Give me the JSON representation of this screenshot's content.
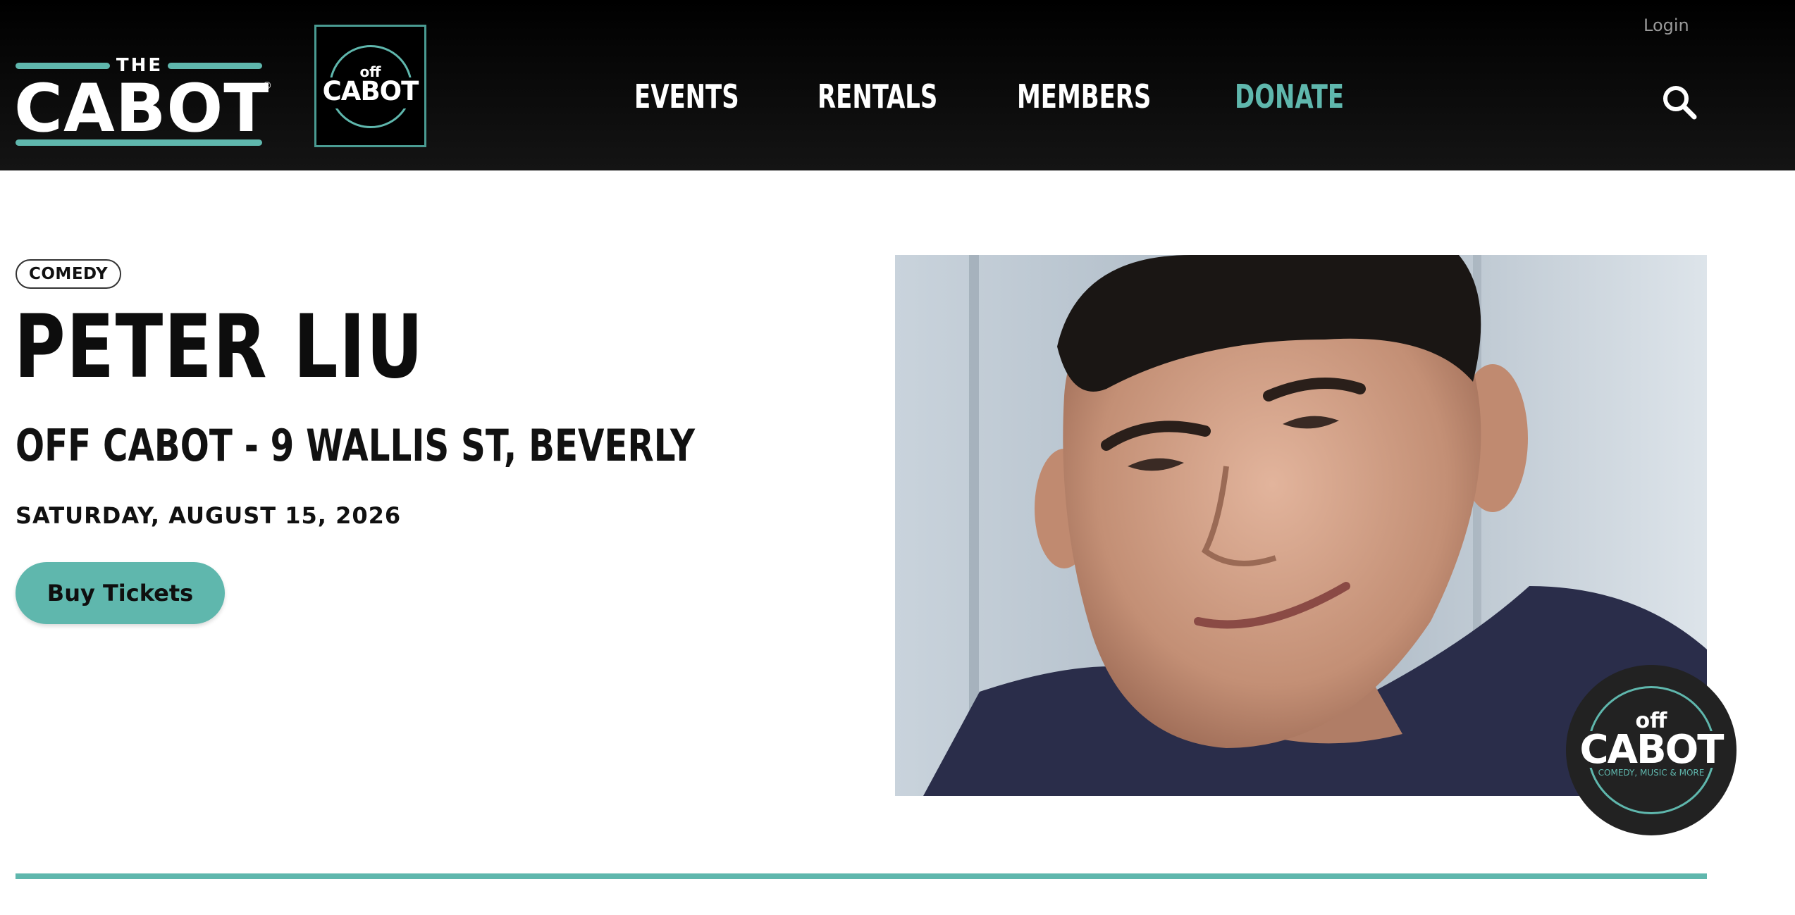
{
  "header": {
    "logo_main": {
      "the": "THE",
      "name": "CABOT",
      "registered": "®"
    },
    "logo_off": {
      "off": "off",
      "name": "CABOT"
    },
    "login": "Login",
    "nav": [
      {
        "label": "EVENTS"
      },
      {
        "label": "RENTALS"
      },
      {
        "label": "MEMBERS"
      },
      {
        "label": "DONATE"
      }
    ],
    "search_icon": "search-icon"
  },
  "event": {
    "category": "COMEDY",
    "title": "PETER LIU",
    "venue": "OFF CABOT - 9 WALLIS ST, BEVERLY",
    "date": "SATURDAY, AUGUST 15, 2026",
    "buy_label": "Buy Tickets"
  },
  "badge": {
    "off": "off",
    "name": "CABOT",
    "tagline": "COMEDY, MUSIC & MORE"
  },
  "colors": {
    "accent": "#5fb7ad",
    "header_bg": "#000000",
    "text": "#0f0f0f"
  }
}
